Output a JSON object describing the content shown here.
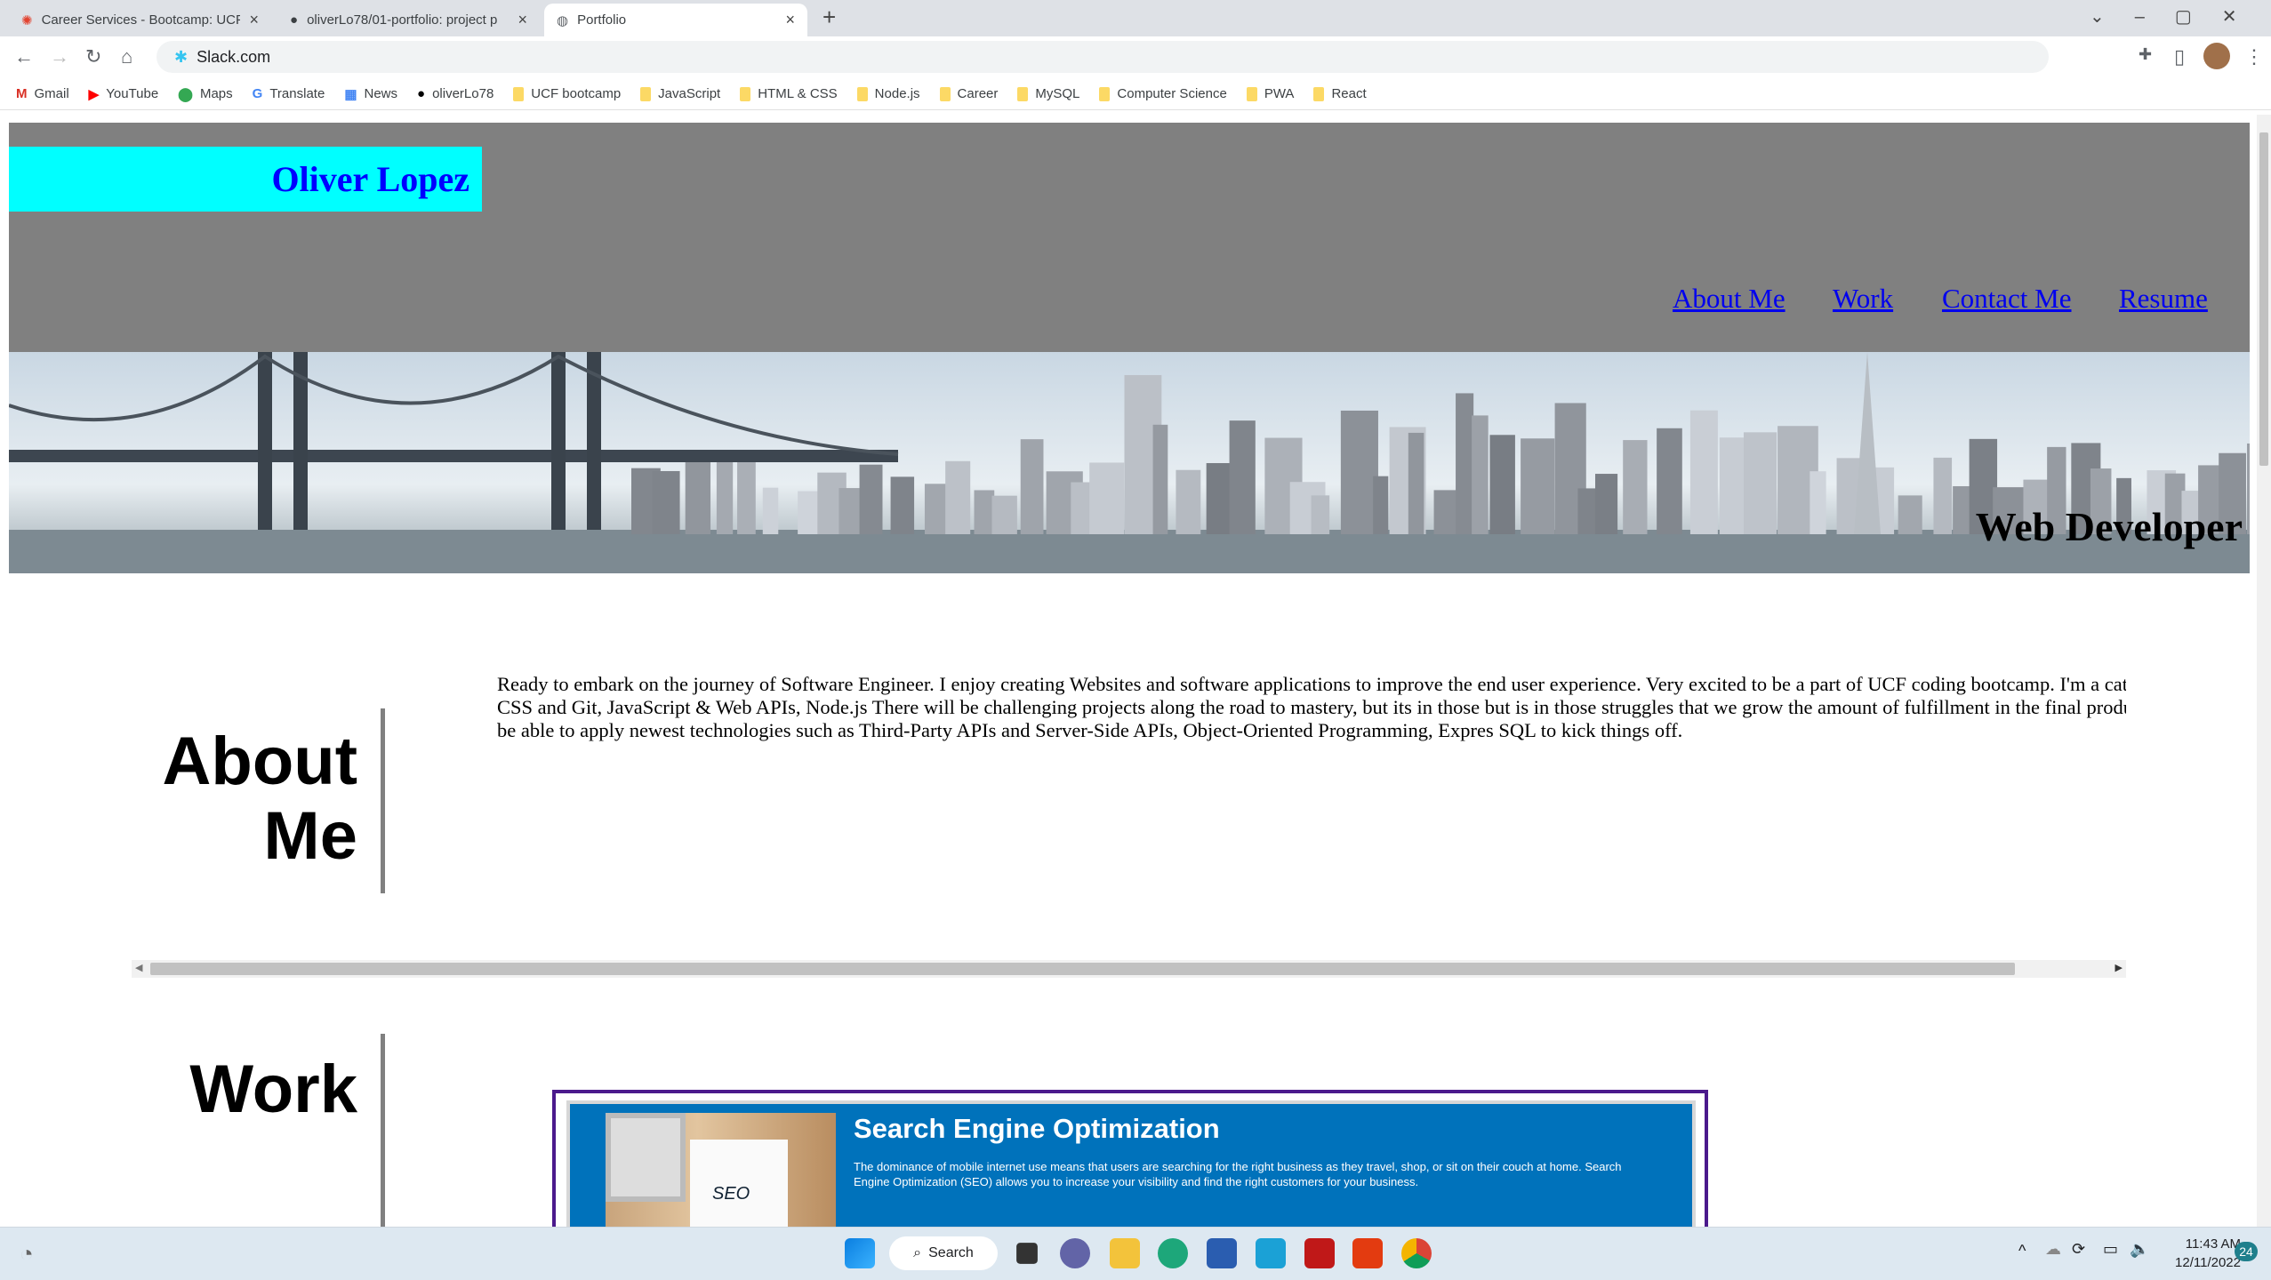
{
  "browser": {
    "tabs": [
      {
        "title": "Career Services - Bootcamp: UCF",
        "icon": "canvas-icon"
      },
      {
        "title": "oliverLo78/01-portfolio: project p",
        "icon": "github-icon"
      },
      {
        "title": "Portfolio",
        "icon": "globe-icon"
      }
    ],
    "address": "Slack.com",
    "bookmarks": [
      {
        "label": "Gmail",
        "icon": "gmail-icon"
      },
      {
        "label": "YouTube",
        "icon": "youtube-icon"
      },
      {
        "label": "Maps",
        "icon": "maps-icon"
      },
      {
        "label": "Translate",
        "icon": "translate-icon"
      },
      {
        "label": "News",
        "icon": "news-icon"
      },
      {
        "label": "oliverLo78",
        "icon": "github-icon"
      },
      {
        "label": "UCF bootcamp",
        "icon": "folder-icon"
      },
      {
        "label": "JavaScript",
        "icon": "folder-icon"
      },
      {
        "label": "HTML & CSS",
        "icon": "folder-icon"
      },
      {
        "label": "Node.js",
        "icon": "folder-icon"
      },
      {
        "label": "Career",
        "icon": "folder-icon"
      },
      {
        "label": "MySQL",
        "icon": "folder-icon"
      },
      {
        "label": "Computer Science",
        "icon": "folder-icon"
      },
      {
        "label": "PWA",
        "icon": "folder-icon"
      },
      {
        "label": "React",
        "icon": "folder-icon"
      }
    ]
  },
  "site": {
    "name": "Oliver Lopez",
    "nav": [
      "About Me",
      "Work",
      "Contact Me",
      "Resume"
    ],
    "banner_caption": "Web Developer",
    "about": {
      "heading_line1": "About",
      "heading_line2": "Me",
      "text": "Ready to embark on the journey of Software Engineer. I enjoy creating Websites and software applications to improve the end user experience. Very excited to be a part of UCF coding bootcamp. I'm a cat plenty of energy in learning HTML & CSS and Git, JavaScript & Web APIs, Node.js There will be challenging projects along the road to mastery, but its in those but is in those struggles that we grow the amount of fulfillment in the final product is worth the effort. I am just happy to be able to apply newest technologies such as Third-Party APIs and Server-Side APIs, Object-Oriented Programming, Expres SQL to kick things off."
    },
    "work": {
      "heading": "Work",
      "card": {
        "title": "Search Engine Optimization",
        "text": "The dominance of mobile internet use means that users are searching for the right business as they travel, shop, or sit on their couch at home. Search Engine Optimization (SEO) allows you to increase your visibility and find the right customers for your business.",
        "image_label": "SEO"
      }
    },
    "colors": {
      "header": "#808080",
      "name_box": "#00ffff",
      "name_text": "#0000ff",
      "card_bg": "#0072bb",
      "card_border": "#4b1a8c"
    }
  },
  "taskbar": {
    "search": "Search",
    "time": "11:43 AM",
    "date": "12/11/2022",
    "notifications": "24"
  }
}
